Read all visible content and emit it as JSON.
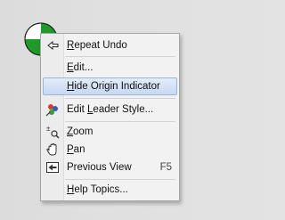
{
  "origin_indicator": {
    "icon": "origin-indicator-icon",
    "colors": [
      "#1e9a28",
      "#ffffff"
    ]
  },
  "context_menu": {
    "items": [
      {
        "label": "Repeat Undo",
        "icon": "repeat-undo-icon",
        "mnemonic": "R"
      },
      {
        "label": "Edit...",
        "mnemonic": "E"
      },
      {
        "label": "Hide Origin Indicator",
        "highlighted": true,
        "mnemonic": "H"
      },
      {
        "label": "Edit Leader Style...",
        "icon": "leader-style-icon",
        "mnemonic": "L"
      },
      {
        "label": "Zoom",
        "icon": "zoom-icon",
        "mnemonic": "Z"
      },
      {
        "label": "Pan",
        "icon": "pan-hand-icon",
        "mnemonic": "P"
      },
      {
        "label": "Previous View",
        "icon": "previous-view-icon",
        "shortcut": "F5"
      },
      {
        "label": "Help Topics...",
        "mnemonic": "H"
      }
    ]
  }
}
